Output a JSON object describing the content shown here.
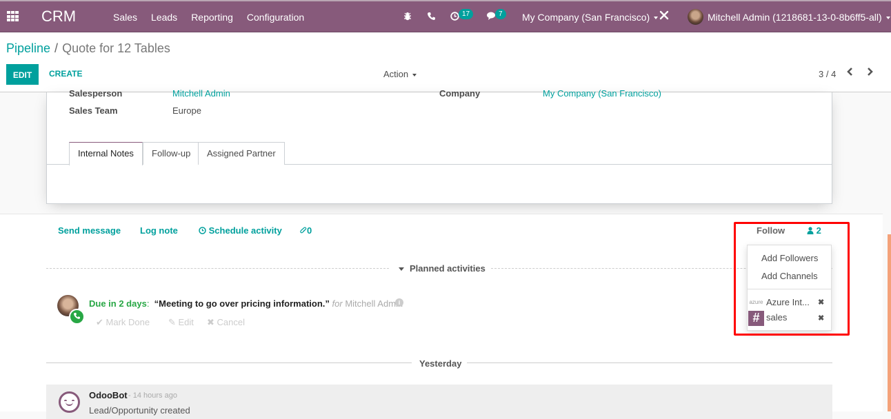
{
  "navbar": {
    "app_name": "CRM",
    "menu": [
      "Sales",
      "Leads",
      "Reporting",
      "Configuration"
    ],
    "icons": {
      "apps": "apps-grid-icon",
      "debug": "bug-icon",
      "phone": "phone-icon",
      "activity": "clock-icon",
      "messaging": "chat-icon",
      "tools": "tools-icon"
    },
    "activity_count": "17",
    "message_count": "7",
    "company": "My Company (San Francisco)",
    "user": "Mitchell Admin (1218681-13-0-8b6ff5-all)",
    "colors": {
      "brand": "#875a7b",
      "accent": "#00a09d"
    }
  },
  "control_panel": {
    "breadcrumb_parent": "Pipeline",
    "breadcrumb_separator": "/",
    "breadcrumb_current": "Quote for 12 Tables",
    "edit_label": "EDIT",
    "create_label": "CREATE",
    "action_label": "Action",
    "pager": "3 / 4",
    "prev_icon": "‹",
    "next_icon": "›"
  },
  "form": {
    "fields": {
      "salesperson_label": "Salesperson",
      "salesperson_value": "Mitchell Admin",
      "sales_team_label": "Sales Team",
      "sales_team_value": "Europe",
      "company_label": "Company",
      "company_value": "My Company (San Francisco)"
    },
    "tabs": [
      "Internal Notes",
      "Follow-up",
      "Assigned Partner"
    ],
    "active_tab": "Internal Notes"
  },
  "chatter": {
    "send_message": "Send message",
    "log_note": "Log note",
    "schedule_activity": "Schedule activity",
    "attachments_count": "0",
    "follow_label": "Follow",
    "followers_count": "2",
    "planned_activities": "Planned activities",
    "activity": {
      "due": "Due in 2 days",
      "colon": ":",
      "summary": "“Meeting to go over pricing information.”",
      "for_label": "for",
      "assignee": "Mitchell Admin",
      "mark_done": "Mark Done",
      "edit": "Edit",
      "cancel": "Cancel",
      "type_icon": "phone-icon"
    },
    "date_separator": "Yesterday",
    "message": {
      "author": "OdooBot",
      "date": "- 14 hours ago",
      "body": "Lead/Opportunity created"
    }
  },
  "followers_dropdown": {
    "add_followers": "Add Followers",
    "add_channels": "Add Channels",
    "followers": [
      {
        "name": "Azure Int...",
        "avatar": "azure"
      },
      {
        "name": "sales",
        "avatar": "#"
      }
    ]
  }
}
